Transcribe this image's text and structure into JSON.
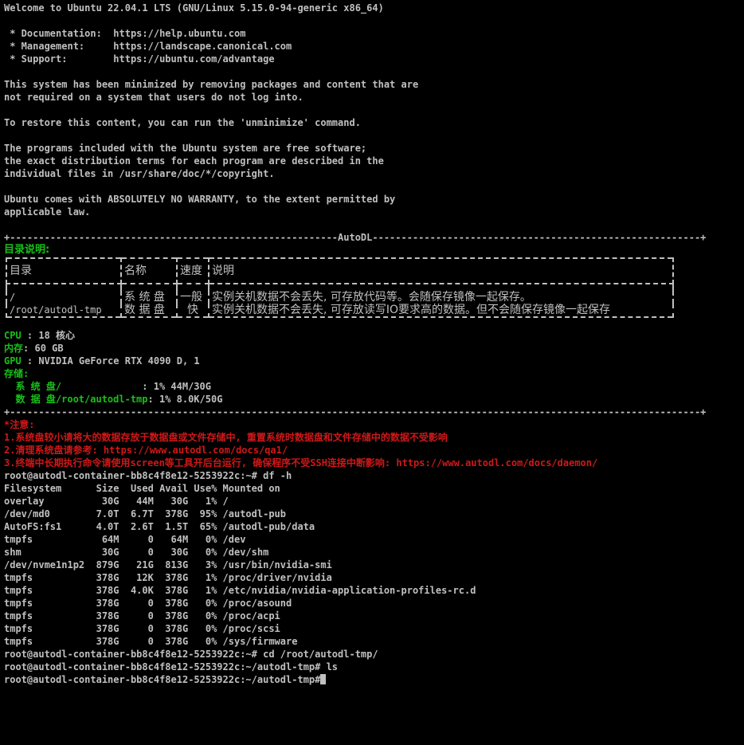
{
  "motd": {
    "welcome": "Welcome to Ubuntu 22.04.1 LTS (GNU/Linux 5.15.0-94-generic x86_64)",
    "doc": " * Documentation:  https://help.ubuntu.com",
    "mgmt": " * Management:     https://landscape.canonical.com",
    "support": " * Support:        https://ubuntu.com/advantage",
    "min1": "This system has been minimized by removing packages and content that are",
    "min2": "not required on a system that users do not log into.",
    "restore": "To restore this content, you can run the 'unminimize' command.",
    "prog1": "The programs included with the Ubuntu system are free software;",
    "prog2": "the exact distribution terms for each program are described in the",
    "prog3": "individual files in /usr/share/doc/*/copyright.",
    "warr1": "Ubuntu comes with ABSOLUTELY NO WARRANTY, to the extent permitted by",
    "warr2": "applicable law."
  },
  "autodl": {
    "separator_top": "+---------------------------------------------------------AutoDL---------------------------------------------------------+",
    "separator_bottom": "+------------------------------------------------------------------------------------------------------------------------+",
    "dir_title": "目录说明:",
    "table": {
      "headers": [
        "目录",
        "名称",
        "速度",
        "说明"
      ],
      "rows": [
        [
          "/",
          "系 统 盘",
          "一般",
          "实例关机数据不会丢失, 可存放代码等。会随保存镜像一起保存。"
        ],
        [
          "/root/autodl-tmp",
          "数 据 盘",
          "快",
          "实例关机数据不会丢失, 可存放读写IO要求高的数据。但不会随保存镜像一起保存"
        ]
      ]
    },
    "cpu_label": "CPU",
    "cpu_value": " : 18 核心",
    "mem_label": "内存",
    "mem_value": ": 60 GB",
    "gpu_label": "GPU",
    "gpu_value": " : NVIDIA GeForce RTX 4090 D, 1",
    "storage_label": "存储:",
    "sys_disk_label": "  系 统 盘/",
    "sys_disk_value": "              : 1% 44M/30G",
    "data_disk_label": "  数 据 盘/root/autodl-tmp",
    "data_disk_value": ": 1% 8.0K/50G",
    "notice_title": "*注意:",
    "notice1": "1.系统盘较小请将大的数据存放于数据盘或文件存储中, 重置系统时数据盘和文件存储中的数据不受影响",
    "notice2": "2.清理系统盘请参考: https://www.autodl.com/docs/qa1/",
    "notice3": "3.终端中长期执行命令请使用screen等工具开后台运行, 确保程序不受SSH连接中断影响: https://www.autodl.com/docs/daemon/"
  },
  "session": {
    "cmd_df": "root@autodl-container-bb8c4f8e12-5253922c:~# df -h",
    "df_header": "Filesystem      Size  Used Avail Use% Mounted on",
    "df_rows": [
      "overlay          30G   44M   30G   1% /",
      "/dev/md0        7.0T  6.7T  378G  95% /autodl-pub",
      "AutoFS:fs1      4.0T  2.6T  1.5T  65% /autodl-pub/data",
      "tmpfs            64M     0   64M   0% /dev",
      "shm              30G     0   30G   0% /dev/shm",
      "/dev/nvme1n1p2  879G   21G  813G   3% /usr/bin/nvidia-smi",
      "tmpfs           378G   12K  378G   1% /proc/driver/nvidia",
      "tmpfs           378G  4.0K  378G   1% /etc/nvidia/nvidia-application-profiles-rc.d",
      "tmpfs           378G     0  378G   0% /proc/asound",
      "tmpfs           378G     0  378G   0% /proc/acpi",
      "tmpfs           378G     0  378G   0% /proc/scsi",
      "tmpfs           378G     0  378G   0% /sys/firmware"
    ],
    "cmd_cd": "root@autodl-container-bb8c4f8e12-5253922c:~# cd /root/autodl-tmp/",
    "cmd_ls": "root@autodl-container-bb8c4f8e12-5253922c:~/autodl-tmp# ls",
    "prompt": "root@autodl-container-bb8c4f8e12-5253922c:~/autodl-tmp#"
  }
}
